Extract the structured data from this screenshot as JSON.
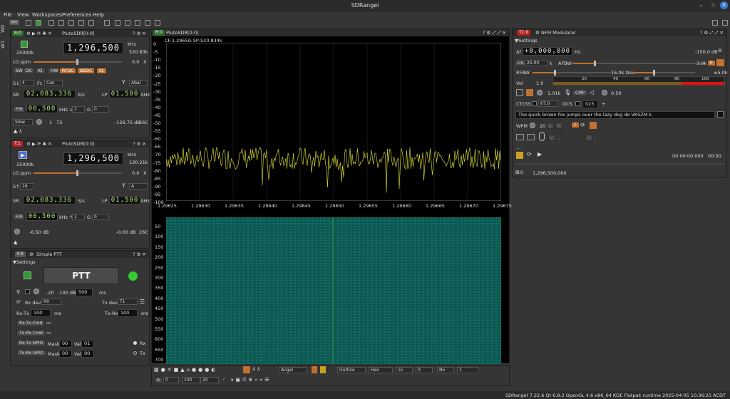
{
  "window": {
    "title": "SDRangel"
  },
  "menu": {
    "file": "File",
    "view": "View",
    "workspaces": "Workspaces",
    "preferences": "Preferences",
    "help": "Help"
  },
  "toolbar": {
    "ws": "W0"
  },
  "vtabs": {
    "w0": "W0",
    "w1": "W1"
  },
  "rx": {
    "tag": "R:0",
    "name": "PlutoSDR[0:0]",
    "rate": "25000k",
    "freq": "1,296,500",
    "unit": "kHz",
    "bw": "520.83k",
    "lo_label": "LO ppm",
    "lo_val": "0.0",
    "lo_x": "X",
    "buttons": [
      "SW",
      "DC",
      "IQ",
      "HW",
      "RFDC",
      "BBDC",
      "IQ"
    ],
    "s_label": "S↓",
    "s_val": "4",
    "fc_label": "Fc",
    "fc_val": "Cen",
    "ant": "Abal",
    "sr_label": "SR",
    "sr_val": "02,083,336",
    "sr_unit": "S/s",
    "lp_label": "LP",
    "lp_val": "01,500",
    "lp_unit": "kHz",
    "fir_label": "FIR",
    "fir_val": "00,500",
    "fir_unit": "kHz ↓",
    "fir_dec": "1",
    "g_label": "G",
    "g_val": "0",
    "gain_mode": "Slow",
    "gain_a": "1",
    "gain_b": "73",
    "db": "-126.75 dB",
    "temp": "26C"
  },
  "tx": {
    "tag": "T:1",
    "name": "PlutoSDR[0:0]",
    "rate": "25000k",
    "freq": "1,296,500",
    "unit": "kHz",
    "bw": "130.21k",
    "lo_label": "LO ppm",
    "lo_val": "0.0",
    "lo_x": "X",
    "s_label": "S↑",
    "s_val": "16",
    "ant": "A",
    "sr_label": "SR",
    "sr_val": "02,083,336",
    "sr_unit": "S/s",
    "lp_label": "LP",
    "lp_val": "01,500",
    "lp_unit": "kHz",
    "fir_label": "FIR",
    "fir_val": "00,500",
    "fir_unit": "kHz ↑",
    "fir_dec": "1",
    "g_label": "G",
    "g_val": "0",
    "att": "-6.50 dB",
    "db": "-0.00 dB",
    "temp": "26C"
  },
  "ptt": {
    "tag": "F:0",
    "name": "Simple PTT",
    "settings": "Settings",
    "button": "PTT",
    "vox_a": "-20",
    "vox_b": "-100 dB",
    "vox_ms": "500",
    "ms": "ms",
    "rxdev_label": "Rx dev",
    "rxdev": "R0",
    "txdev_label": "Tx dev",
    "txdev": "T1",
    "rxtx_label": "Rx-Tx",
    "rxtx": "100",
    "txrx_label": "Tx-Rx",
    "txrx": "100",
    "rxtx_cmd": "Rx-Tx Cmd",
    "txrx_cmd": "Tx-Rx Cmd",
    "rxtx_gpio": "Rx-Tx GPIO",
    "txrx_gpio": "Tx-Rx GPIO",
    "mask": "Mask",
    "mask1": "00",
    "mask2": "00",
    "val": "Val",
    "val1": "01",
    "val2": "00",
    "rx": "Rx",
    "tx": "Tx"
  },
  "spectrum": {
    "tag": "R:0",
    "name": "PlutoSDR[0:0]",
    "info": "CF:1.2965G SP:520.834k",
    "yticks": [
      "0",
      "-5",
      "-10",
      "-15",
      "-20",
      "-25",
      "-30",
      "-35",
      "-40",
      "-45",
      "-50",
      "-55",
      "-60",
      "-65",
      "-70",
      "-75",
      "-80",
      "-85",
      "-90",
      "-95",
      "-100"
    ],
    "xticks": [
      "1.29625",
      "1.29630",
      "1.29635",
      "1.29640",
      "1.29645",
      "1.29650",
      "1.29655",
      "1.29660",
      "1.29665",
      "1.29670",
      "1.29675"
    ],
    "wticks": [
      "50",
      "100",
      "150",
      "200",
      "250",
      "300",
      "350",
      "400",
      "450",
      "500",
      "550",
      "600",
      "650",
      "700"
    ],
    "ctl": {
      "angel": "Angel",
      "outline": "Outline",
      "han": "Han",
      "k1": "1k",
      "zero": "0",
      "no": "No",
      "one": "1",
      "a": "A",
      "z": "0",
      "hund": "100",
      "twenty": "20"
    }
  },
  "nfm": {
    "tag": "T1:0",
    "name": "NFM Modulator",
    "settings": "Settings",
    "df_label": "Δf",
    "df_val": "+0,000,000",
    "hz": "Hz",
    "db": "-150.0 dB",
    "cs_label": "CS",
    "cs_val": "25.00",
    "k": "k",
    "afbw_label": "AFBW",
    "afbw_val": "3.0k",
    "p": "P",
    "rfbw_label": "RFBW",
    "dev_label": "16.0k Dev",
    "dev_val": "±5.0k",
    "vol_label": "Vol",
    "vol_val": "1.0",
    "scale": [
      "20",
      "40",
      "60",
      "80",
      "100"
    ],
    "tone": "1.01k",
    "cmp": "CMP",
    "cmp_val": "0.50",
    "ctcss_label": "CTCSS",
    "ctcss_val": "67.0",
    "dcs_label": "DCS",
    "dcs_val": "023",
    "plus": "+",
    "text": "The quick brown fox jumps over the lazy dog de VK5ZM k",
    "wpm_label": "WPM",
    "wpm_val": "20",
    "dot1": ".",
    "dot2": "-",
    "dot3": ".",
    "dot4": "-",
    "dot5": ".",
    "dots": "...",
    "t1": "00:00:00.000",
    "t2": "00:00",
    "freq": "1,296,500,000"
  },
  "statusbar": {
    "text": "SDRangel 7.22.6 Qt 6.8.2 OpenGL 4.6 x86_64 KDE Flatpak runtime  2025-04-05 10:36:25 ACDT"
  }
}
